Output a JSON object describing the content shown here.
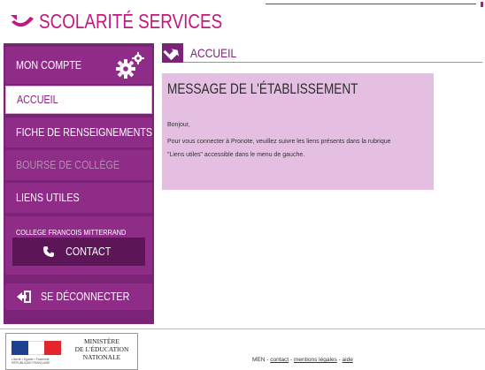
{
  "header": {
    "brand": "Scolarité Services",
    "brand_color": "#c0187f"
  },
  "sidebar": {
    "account": {
      "label": "MON COMPTE",
      "icon": "gears-icon"
    },
    "items": [
      {
        "label": "ACCUEIL",
        "state": "active"
      },
      {
        "label": "FICHE DE RENSEIGNEMENTS",
        "state": "normal"
      },
      {
        "label": "BOURSE DE COLLÈGE",
        "state": "disabled"
      },
      {
        "label": "LIENS UTILES",
        "state": "normal"
      }
    ],
    "school_name": "COLLEGE FRANCOIS MITTERRAND",
    "contact_label": "CONTACT",
    "logout_label": "SE DÉCONNECTER",
    "accent": "#7b2377"
  },
  "main": {
    "section_title": "ACCUEIL",
    "message": {
      "title": "MESSAGE DE L'ÉTABLISSEMENT",
      "lines": [
        "Bonjour,",
        "Pour vous connecter à Pronote, veuillez suivre les liens présents dans la rubrique",
        "\"Liens utiles\" accessible dans le menu de gauche."
      ],
      "background": "#e4bfe2"
    }
  },
  "footer": {
    "ministry_lines": [
      "MINISTÈRE",
      "DE L'ÉDUCATION",
      "NATIONALE"
    ],
    "motto": "Liberté • Égalité • Fraternité",
    "republic": "RÉPUBLIQUE FRANÇAISE",
    "prefix": "MEN - ",
    "links": [
      "contact",
      "mentions légales",
      "aide"
    ],
    "separator": " - "
  }
}
